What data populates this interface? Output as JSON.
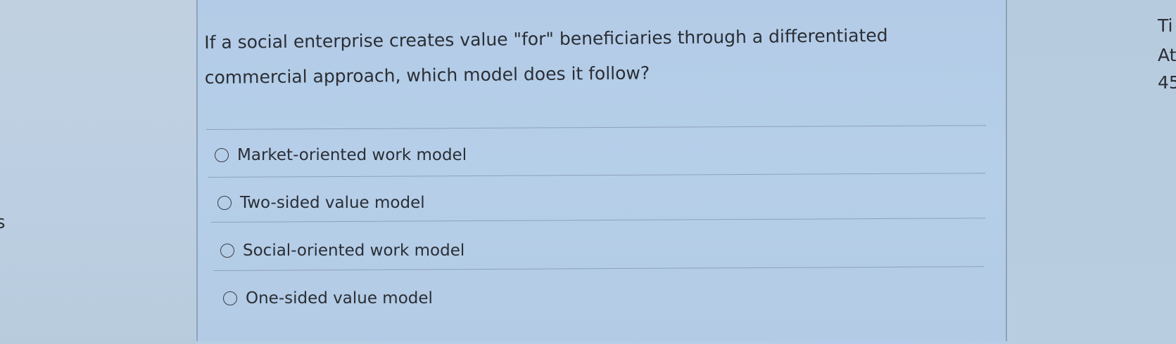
{
  "question": {
    "text": "If a social enterprise creates value \"for\" beneficiaries through a differentiated commercial approach, which model does it follow?"
  },
  "options": [
    {
      "label": "Market-oriented work model",
      "selected": false
    },
    {
      "label": "Two-sided value model",
      "selected": false
    },
    {
      "label": "Social-oriented work model",
      "selected": false
    },
    {
      "label": "One-sided value model",
      "selected": false
    }
  ],
  "right_panel": {
    "line1": "Ti",
    "line2": "At",
    "line3": "45"
  },
  "left_edge": {
    "letter": "s"
  }
}
